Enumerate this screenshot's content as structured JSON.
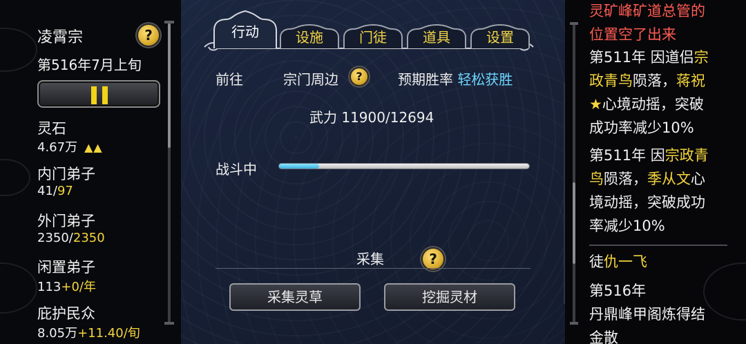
{
  "left": {
    "sect_name": "凌霄宗",
    "date": "第516年7月上旬",
    "help_glyph": "?",
    "stats": [
      {
        "label": "灵石",
        "value": "4.67万",
        "extra": "",
        "trend": "▲▲"
      },
      {
        "label": "内门弟子",
        "value": "41/",
        "extra": "97",
        "trend": ""
      },
      {
        "label": "外门弟子",
        "value": "2350/",
        "extra": "2350",
        "trend": ""
      },
      {
        "label": "闲置弟子",
        "value": "113",
        "extra": "+0/年",
        "trend": ""
      },
      {
        "label": "庇护民众",
        "value": "8.05万",
        "extra": "+11.40/旬",
        "trend": ""
      }
    ]
  },
  "tabs": [
    {
      "label": "行动",
      "active": true
    },
    {
      "label": "设施",
      "active": false
    },
    {
      "label": "门徒",
      "active": false
    },
    {
      "label": "道具",
      "active": false
    },
    {
      "label": "设置",
      "active": false
    }
  ],
  "action": {
    "goto_label": "前往",
    "location": "宗门周边",
    "win_rate_label": "预期胜率",
    "win_rate_value": "轻松获胜",
    "force": "武力 11900/12694",
    "battle_label": "战斗中",
    "battle_progress": 0.16
  },
  "gather": {
    "title": "采集",
    "buttons": [
      "采集灵草",
      "挖掘灵材"
    ]
  },
  "log": {
    "top_headline_1": "灵矿峰矿道总管的",
    "top_headline_2": "位置空了出来",
    "entry1": [
      "第511年 因道侣",
      "宗",
      "政青鸟",
      "陨落，",
      "蒋祝",
      "★",
      "心境动摇，突破",
      "成功率减少10%"
    ],
    "entry2": [
      "第511年 因",
      "宗政青",
      "鸟",
      "陨落，",
      "季从文",
      "心",
      "境动摇，突破成功",
      "率减少10%"
    ],
    "disciple_prefix": "徒",
    "disciple_name": "仇一飞",
    "entry3": [
      "第516年",
      "丹鼎峰甲阁炼得结",
      "金散"
    ]
  },
  "colors": {
    "accent_yellow": "#f4d53c",
    "accent_cyan": "#6fd6ff",
    "alert_red": "#ff5b52"
  }
}
